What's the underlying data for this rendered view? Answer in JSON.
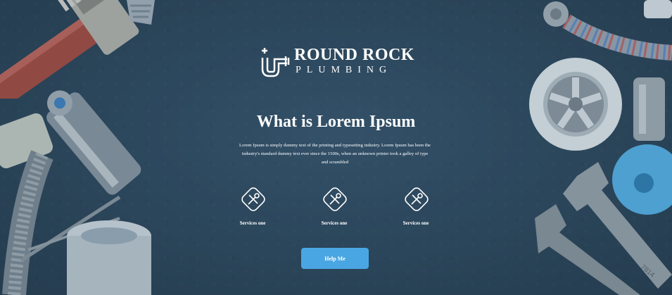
{
  "brand": {
    "name": "ROUND ROCK",
    "subtitle": "PLUMBING"
  },
  "hero": {
    "title": "What is Lorem Ipsum",
    "description": "Lorem Ipsum is simply dummy text of the printing and typesetting industry. Lorem Ipsum has been the industry's standard dummy text ever since the 1500s, when an unknown printer took a galley of type and scrambled"
  },
  "services": [
    {
      "label": "Services one",
      "icon": "wrench-screwdriver-icon"
    },
    {
      "label": "Services one",
      "icon": "wrench-screwdriver-icon"
    },
    {
      "label": "Services one",
      "icon": "wrench-screwdriver-icon"
    }
  ],
  "cta": {
    "label": "Help Me"
  },
  "colors": {
    "background": "#2f4a60",
    "accent": "#4aa6e2",
    "text": "#ffffff"
  }
}
